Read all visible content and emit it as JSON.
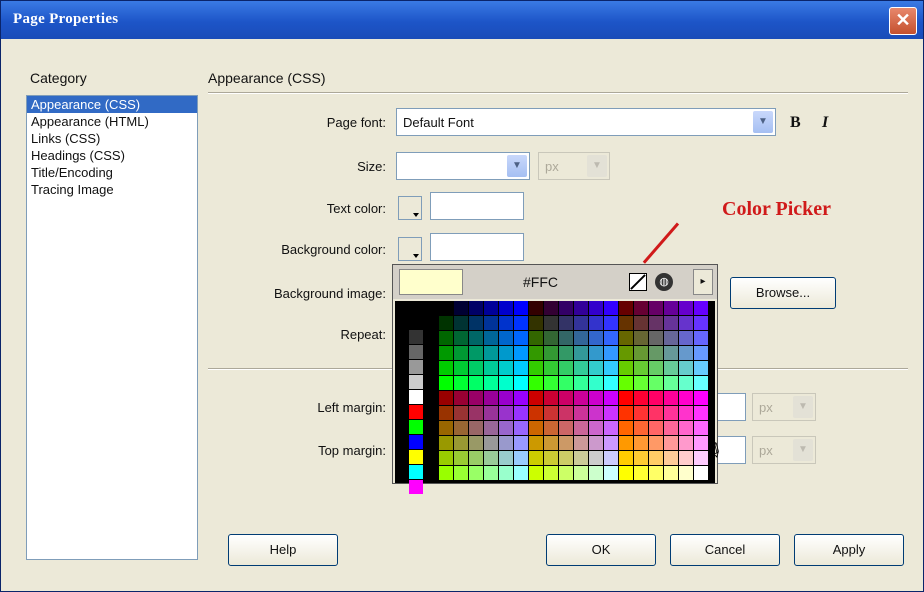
{
  "window": {
    "title": "Page Properties",
    "close_label": "✕"
  },
  "category": {
    "header": "Category",
    "items": [
      "Appearance (CSS)",
      "Appearance (HTML)",
      "Links (CSS)",
      "Headings (CSS)",
      "Title/Encoding",
      "Tracing Image"
    ],
    "selected_index": 0
  },
  "section": {
    "title": "Appearance (CSS)"
  },
  "form": {
    "page_font_label": "Page font:",
    "page_font_value": "Default Font",
    "bold_label": "B",
    "italic_label": "I",
    "size_label": "Size:",
    "size_value": "",
    "size_unit": "px",
    "text_color_label": "Text color:",
    "bg_color_label": "Background color:",
    "bg_image_label": "Background image:",
    "browse_label": "Browse...",
    "repeat_label": "Repeat:",
    "left_margin_label": "Left margin:",
    "top_margin_label": "Top margin:",
    "margin_unit": "px"
  },
  "buttons": {
    "help": "Help",
    "ok": "OK",
    "cancel": "Cancel",
    "apply": "Apply"
  },
  "picker": {
    "hex_value": "#FFC",
    "preview_color": "#ffffcc",
    "system_icon": "globe-icon",
    "nocolor_icon": "no-color-icon",
    "menu_arrow": "▸",
    "left_column_colors": [
      "#000000",
      "#333333",
      "#666666",
      "#999999",
      "#cccccc",
      "#ffffff",
      "#ff0000",
      "#00ff00",
      "#0000ff",
      "#ffff00",
      "#00ffff",
      "#ff00ff"
    ]
  },
  "annotation": {
    "label": "Color Picker"
  },
  "colors": {
    "title_bar": "#1d55c8",
    "selection": "#316ac5",
    "annotation": "#d01a1a"
  }
}
